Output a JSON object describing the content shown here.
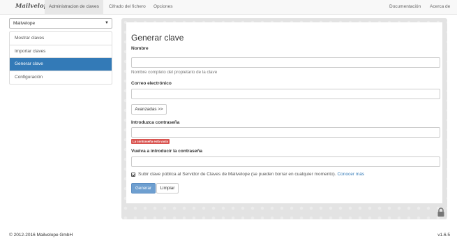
{
  "navbar": {
    "brand": "Mailvelope",
    "left_items": [
      "Administracion de claves",
      "Cifrado del fichero",
      "Opciones"
    ],
    "active_index": 0,
    "right_items": [
      "Documentación",
      "Acerca de"
    ]
  },
  "sidebar": {
    "keyring_select": "Mailvelope",
    "items": [
      {
        "label": "Mostrar claves"
      },
      {
        "label": "Importar claves"
      },
      {
        "label": "Generar clave"
      },
      {
        "label": "Configuración"
      }
    ],
    "active_index": 2
  },
  "form": {
    "title": "Generar clave",
    "name_label": "Nombre",
    "name_value": "",
    "name_help": "Nombre completo del propietario de la clave",
    "email_label": "Correo electrónico",
    "email_value": "",
    "advanced_button": "Avanzadas >>",
    "password_label": "Introduzca contraseña",
    "password_value": "",
    "password_error": "La contraseña está vacía",
    "password_repeat_label": "Vuelva a introducir la contraseña",
    "password_repeat_value": "",
    "upload_checked": true,
    "upload_text": "Subir clave pública al Servidor de Claves de Mailvelope (se pueden borrar en cualquier momento).",
    "learn_more": "Conocer más",
    "generate_button": "Generar",
    "clear_button": "Limpiar"
  },
  "footer": {
    "copyright": "© 2012-2016 Mailvelope GmbH",
    "version": "v1.6.5"
  },
  "colors": {
    "primary": "#337ab7",
    "danger": "#d9534f",
    "navbar_bg": "#f8f8f8",
    "panel_bg": "#e3e3e3"
  },
  "icons": {
    "dropdown": "caret-down-icon",
    "security": "lock-icon"
  }
}
